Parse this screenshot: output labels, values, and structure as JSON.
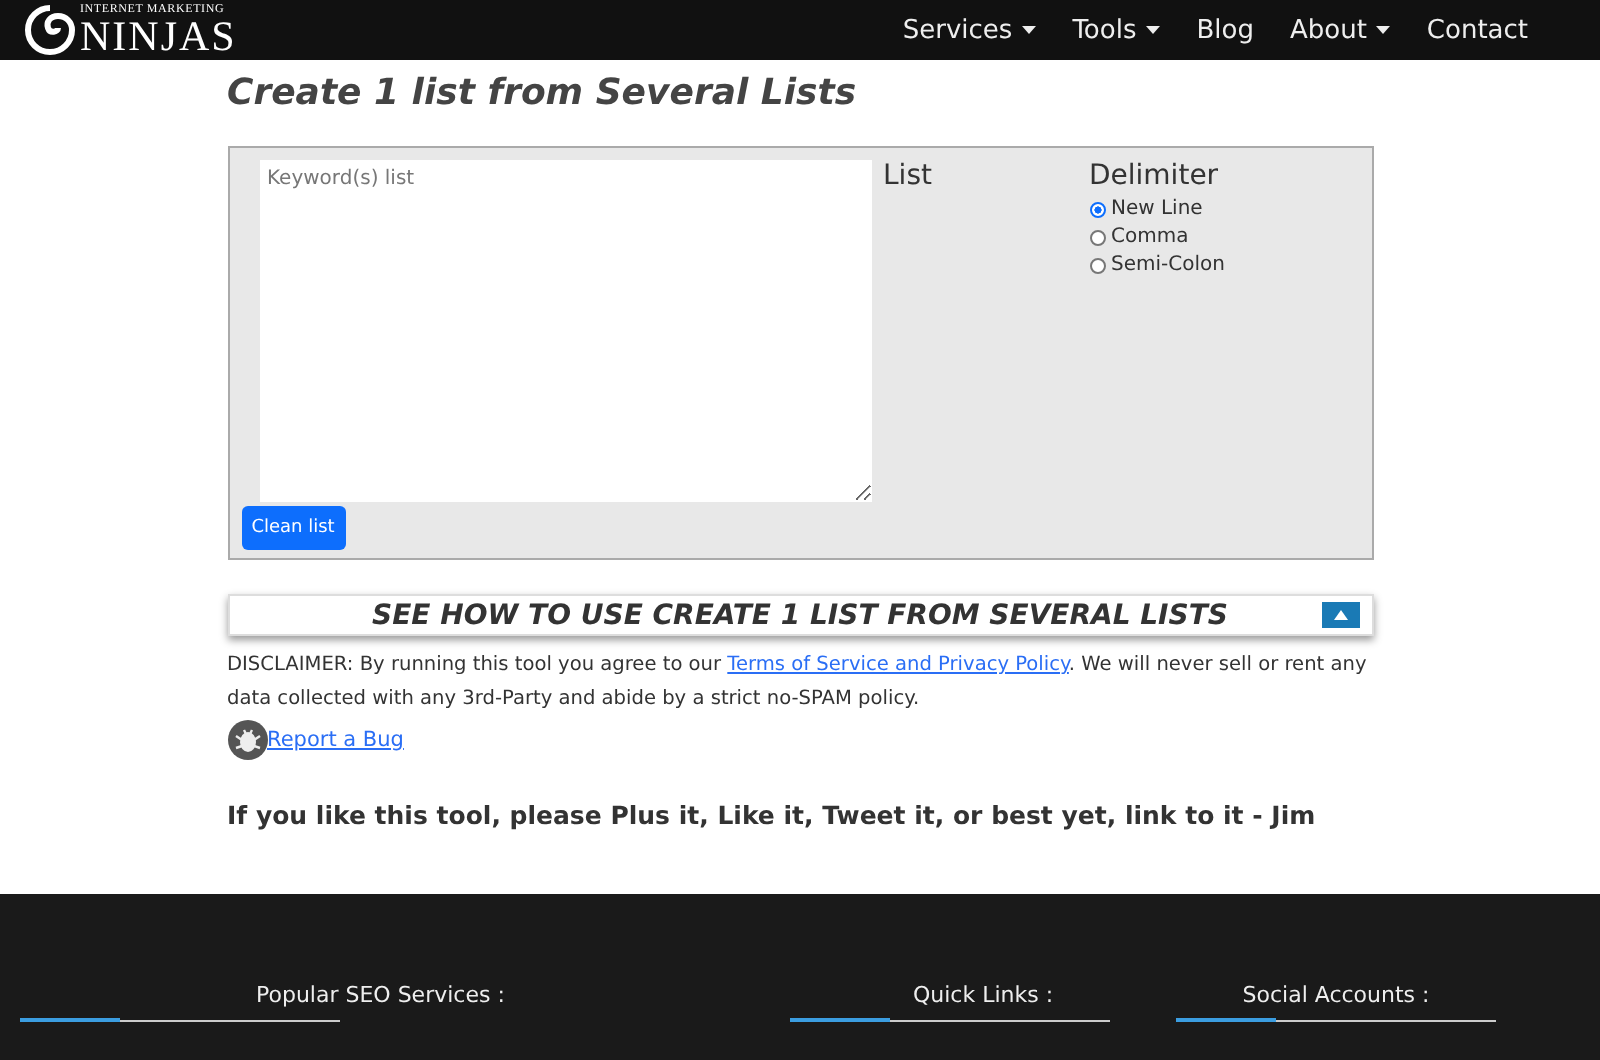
{
  "nav": {
    "logo": {
      "tagline": "INTERNET MARKETING",
      "name": "NINJAS"
    },
    "items": [
      {
        "label": "Services",
        "dropdown": true
      },
      {
        "label": "Tools",
        "dropdown": true
      },
      {
        "label": "Blog",
        "dropdown": false
      },
      {
        "label": "About",
        "dropdown": true
      },
      {
        "label": "Contact",
        "dropdown": false
      }
    ]
  },
  "title": "Create 1 list from Several Lists",
  "tool": {
    "textarea": {
      "placeholder": "Keyword(s) list"
    },
    "list_label": "List",
    "delimiter_label": "Delimiter",
    "options": [
      {
        "label": "New Line",
        "selected": true
      },
      {
        "label": "Comma",
        "selected": false
      },
      {
        "label": "Semi-Colon",
        "selected": false
      }
    ],
    "button": "Clean list"
  },
  "howto": {
    "title": "SEE HOW TO USE CREATE 1 LIST FROM SEVERAL LISTS"
  },
  "disclaimer": {
    "before": "DISCLAIMER: By running this tool you agree to our ",
    "link": "Terms of Service and Privacy Policy",
    "after": ". We will never sell or rent any data collected with any 3rd-Party and abide by a strict no-SPAM policy."
  },
  "report_link": "Report a Bug",
  "like_text": "If you like this tool, please Plus it, Like it, Tweet it, or best yet, link to it - Jim",
  "footer": {
    "headings": [
      "Popular SEO Services :",
      "Quick Links :",
      "Social Accounts :"
    ]
  }
}
